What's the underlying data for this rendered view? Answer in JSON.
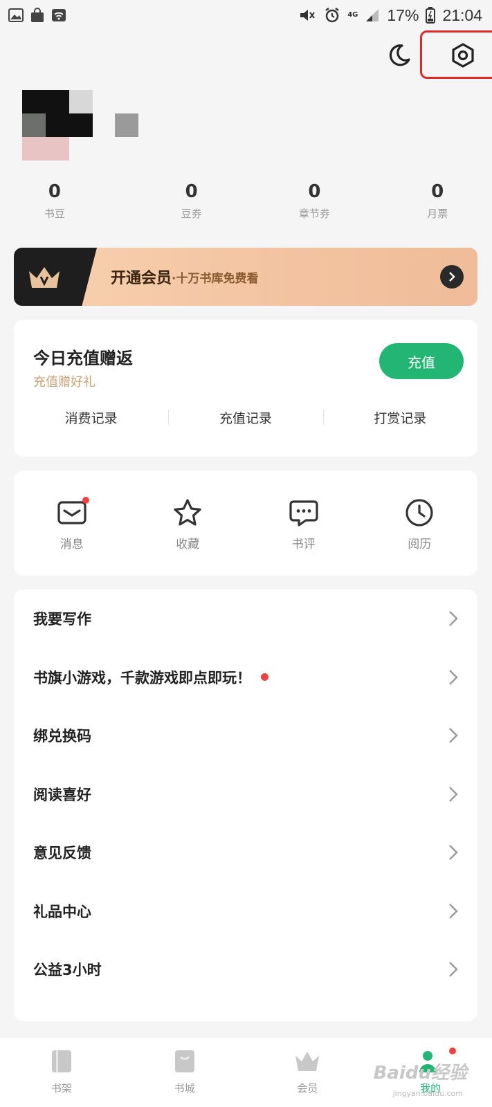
{
  "status_bar": {
    "battery_percent": "17%",
    "time": "21:04",
    "network": "4G"
  },
  "stats": [
    {
      "value": "0",
      "label": "书豆"
    },
    {
      "value": "0",
      "label": "豆券"
    },
    {
      "value": "0",
      "label": "章节券"
    },
    {
      "value": "0",
      "label": "月票"
    }
  ],
  "vip": {
    "title": "开通会员",
    "subtitle": "·十万书库免费看"
  },
  "recharge": {
    "title": "今日充值赠返",
    "subtitle": "充值赠好礼",
    "button": "充值",
    "links": [
      "消费记录",
      "充值记录",
      "打赏记录"
    ]
  },
  "shortcuts": [
    {
      "label": "消息",
      "icon": "mail-icon",
      "badge": true
    },
    {
      "label": "收藏",
      "icon": "star-icon",
      "badge": false
    },
    {
      "label": "书评",
      "icon": "chat-bubble-icon",
      "badge": false
    },
    {
      "label": "阅历",
      "icon": "clock-icon",
      "badge": false
    }
  ],
  "menu": [
    {
      "label": "我要写作",
      "badge": false
    },
    {
      "label": "书旗小游戏，千款游戏即点即玩！",
      "badge": true
    },
    {
      "label": "绑兑换码",
      "badge": false
    },
    {
      "label": "阅读喜好",
      "badge": false
    },
    {
      "label": "意见反馈",
      "badge": false
    },
    {
      "label": "礼品中心",
      "badge": false
    },
    {
      "label": "公益3小时",
      "badge": false
    }
  ],
  "tabs": [
    {
      "label": "书架",
      "active": false
    },
    {
      "label": "书城",
      "active": false
    },
    {
      "label": "会员",
      "active": false
    },
    {
      "label": "我的",
      "active": true
    }
  ],
  "watermark": {
    "brand": "Baidu经验",
    "url": "jingyan.baidu.com"
  },
  "colors": {
    "accent": "#23b574",
    "badge": "#f04141",
    "highlight": "#e02a2a"
  }
}
